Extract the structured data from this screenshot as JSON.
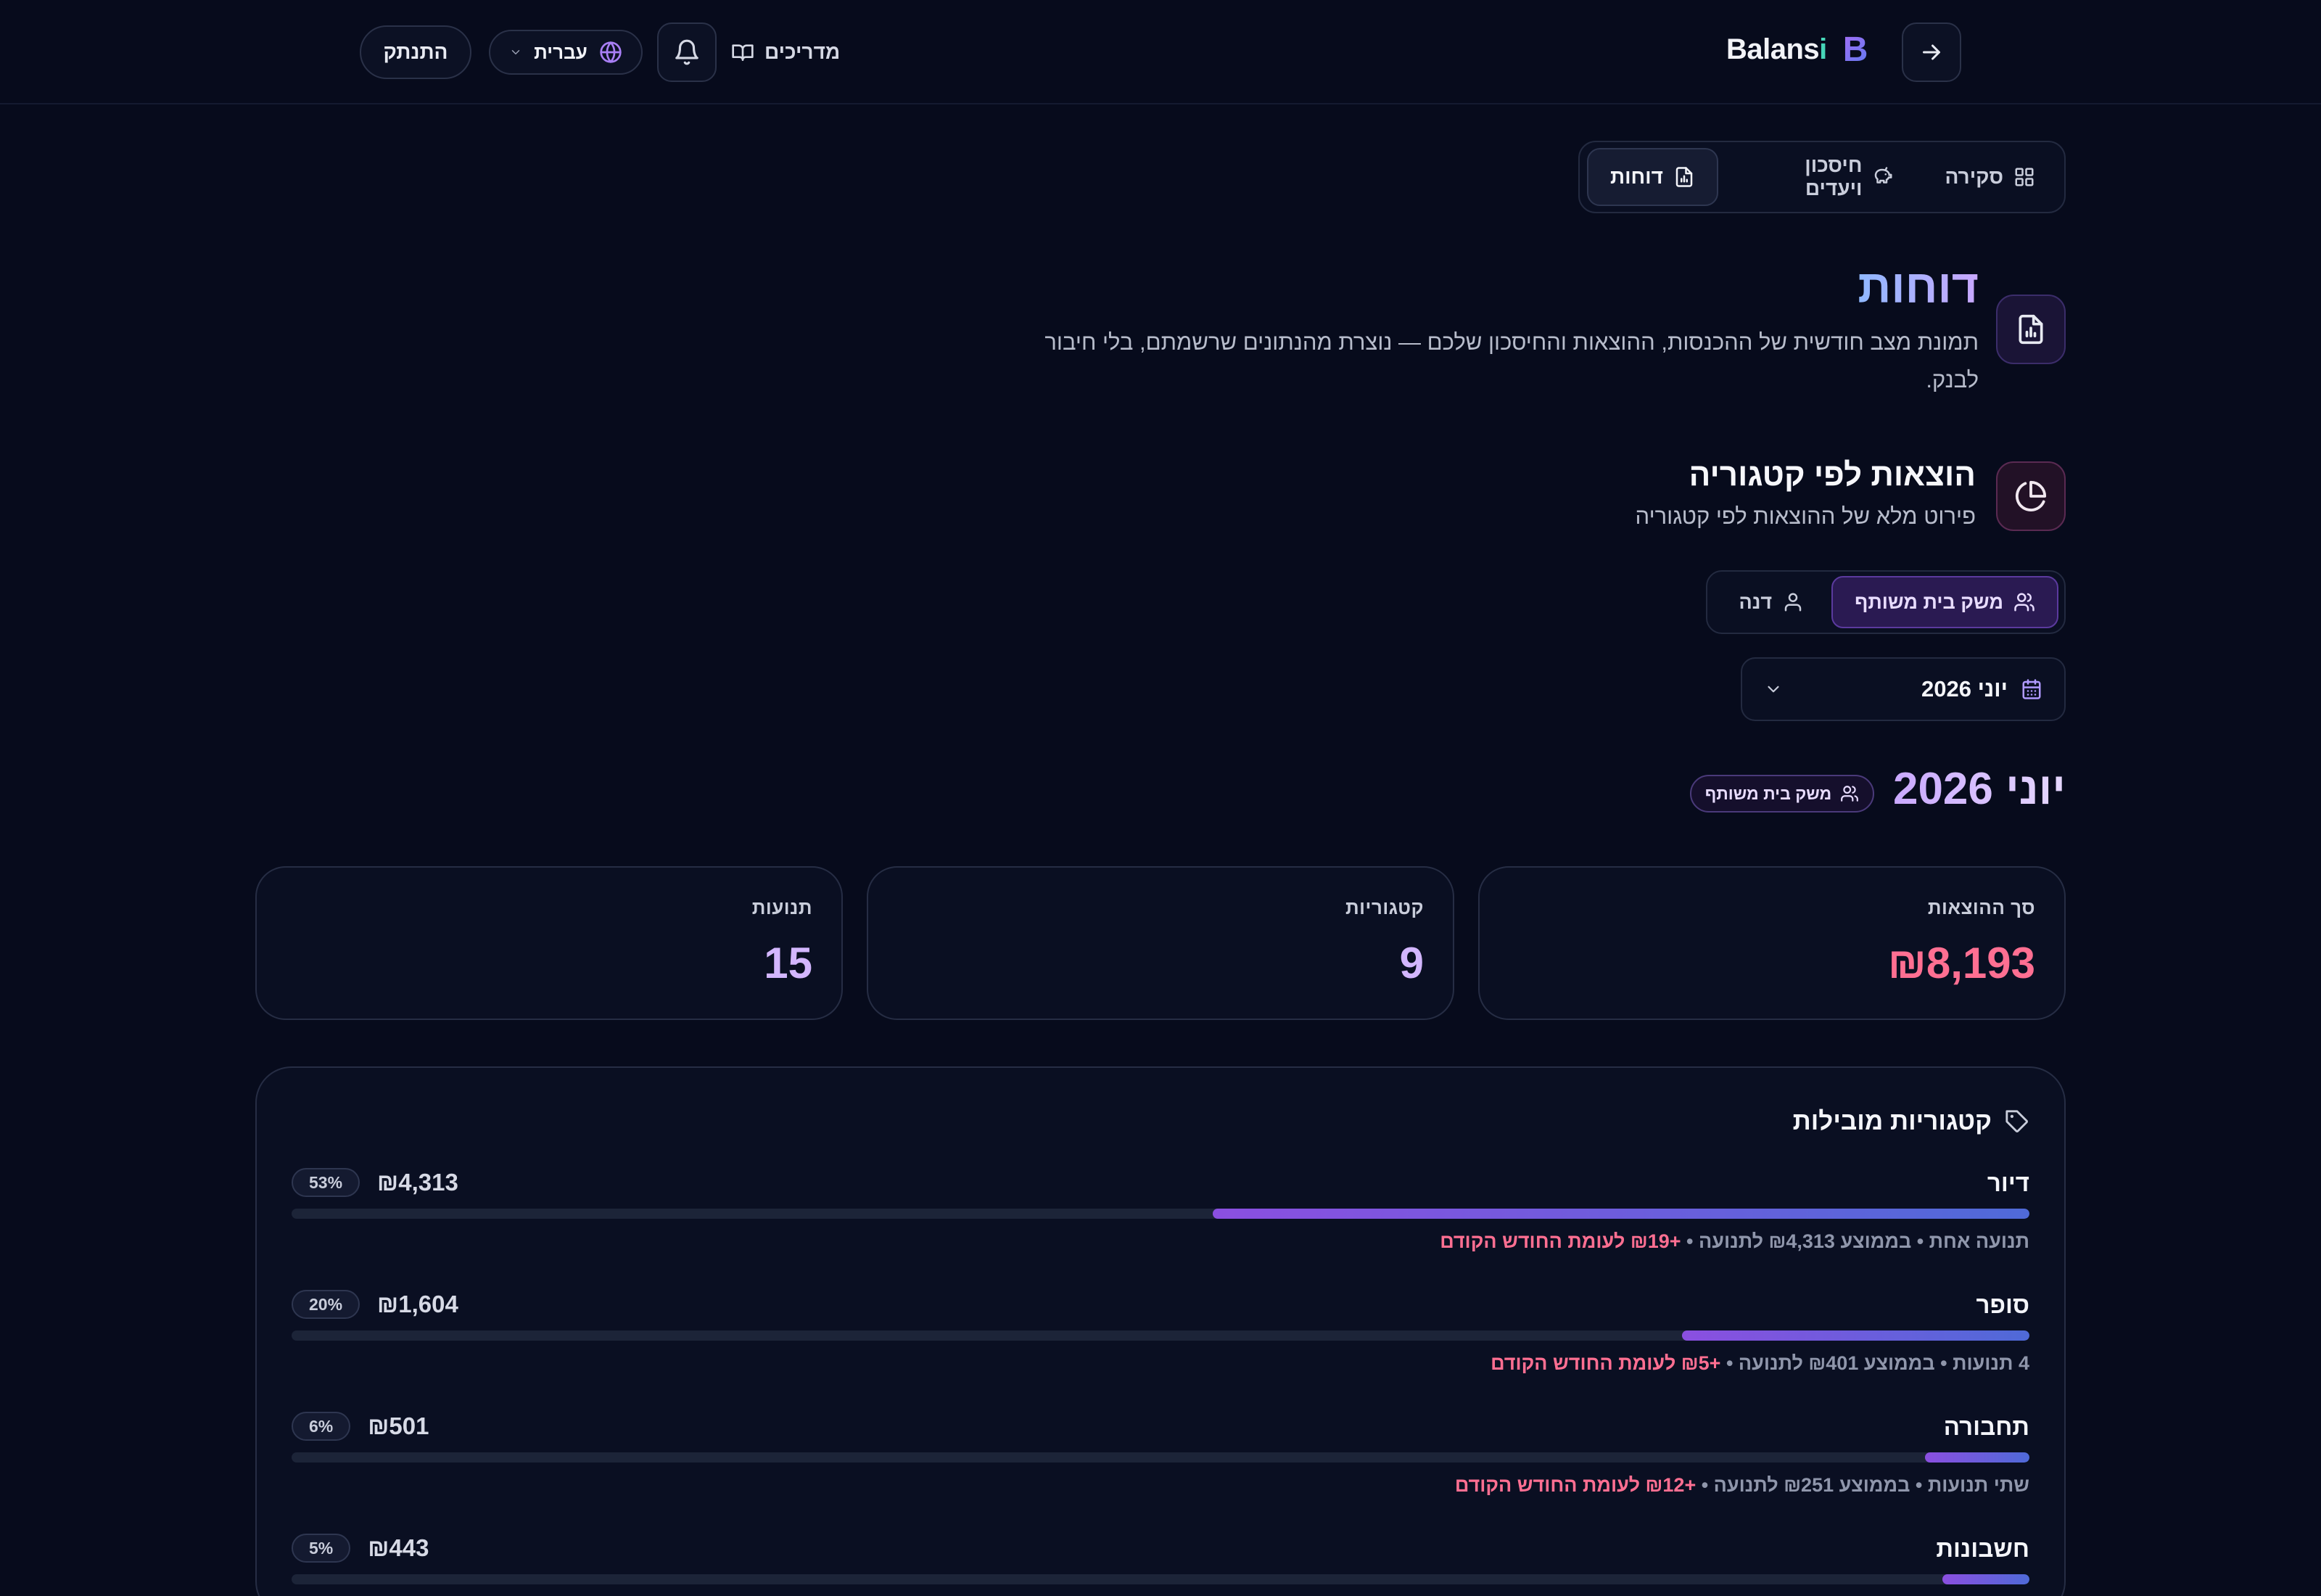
{
  "app": {
    "name_main": "Balans",
    "name_accent": "i",
    "mark": "B"
  },
  "header": {
    "guides_label": "מדריכים",
    "language_label": "עברית",
    "logout_label": "התנתק"
  },
  "tabs": [
    {
      "label": "סקירה",
      "active": false
    },
    {
      "label": "חיסכון ויעדים",
      "active": false
    },
    {
      "label": "דוחות",
      "active": true
    }
  ],
  "page": {
    "title": "דוחות",
    "description": "תמונת מצב חודשית של ההכנסות, ההוצאות והחיסכון שלכם — נוצרת מהנתונים שרשמתם, בלי חיבור לבנק."
  },
  "section": {
    "title": "הוצאות לפי קטגוריה",
    "subtitle": "פירוט מלא של ההוצאות לפי קטגוריה"
  },
  "scope": {
    "options": [
      {
        "label": "משק בית משותף",
        "active": true
      },
      {
        "label": "דנה",
        "active": false
      }
    ]
  },
  "month_select": {
    "value": "יוני 2026"
  },
  "summary": {
    "month_heading": "יוני 2026",
    "scope_badge": "משק בית משותף",
    "cards": [
      {
        "label": "סך ההוצאות",
        "value": "₪8,193",
        "color": "#ff6f92"
      },
      {
        "label": "קטגוריות",
        "value": "9",
        "color": "#d3b6ff"
      },
      {
        "label": "תנועות",
        "value": "15",
        "color": "#d3b6ff"
      }
    ]
  },
  "top_categories": {
    "title": "קטגוריות מובילות",
    "items": [
      {
        "name": "דיור",
        "amount": "₪4,313",
        "percent_label": "53%",
        "share": 0.47,
        "meta": "תנועה אחת • בממוצע ₪4,313 לתנועה • ",
        "delta": "+₪19 לעומת החודש הקודם"
      },
      {
        "name": "סופר",
        "amount": "₪1,604",
        "percent_label": "20%",
        "share": 0.2,
        "meta": "4 תנועות • בממוצע ₪401 לתנועה • ",
        "delta": "+₪5 לעומת החודש הקודם"
      },
      {
        "name": "תחבורה",
        "amount": "₪501",
        "percent_label": "6%",
        "share": 0.06,
        "meta": "שתי תנועות • בממוצע ₪251 לתנועה • ",
        "delta": "+₪12 לעומת החודש הקודם"
      },
      {
        "name": "חשבונות",
        "amount": "₪443",
        "percent_label": "5%",
        "share": 0.05,
        "meta": "",
        "delta": ""
      }
    ]
  }
}
